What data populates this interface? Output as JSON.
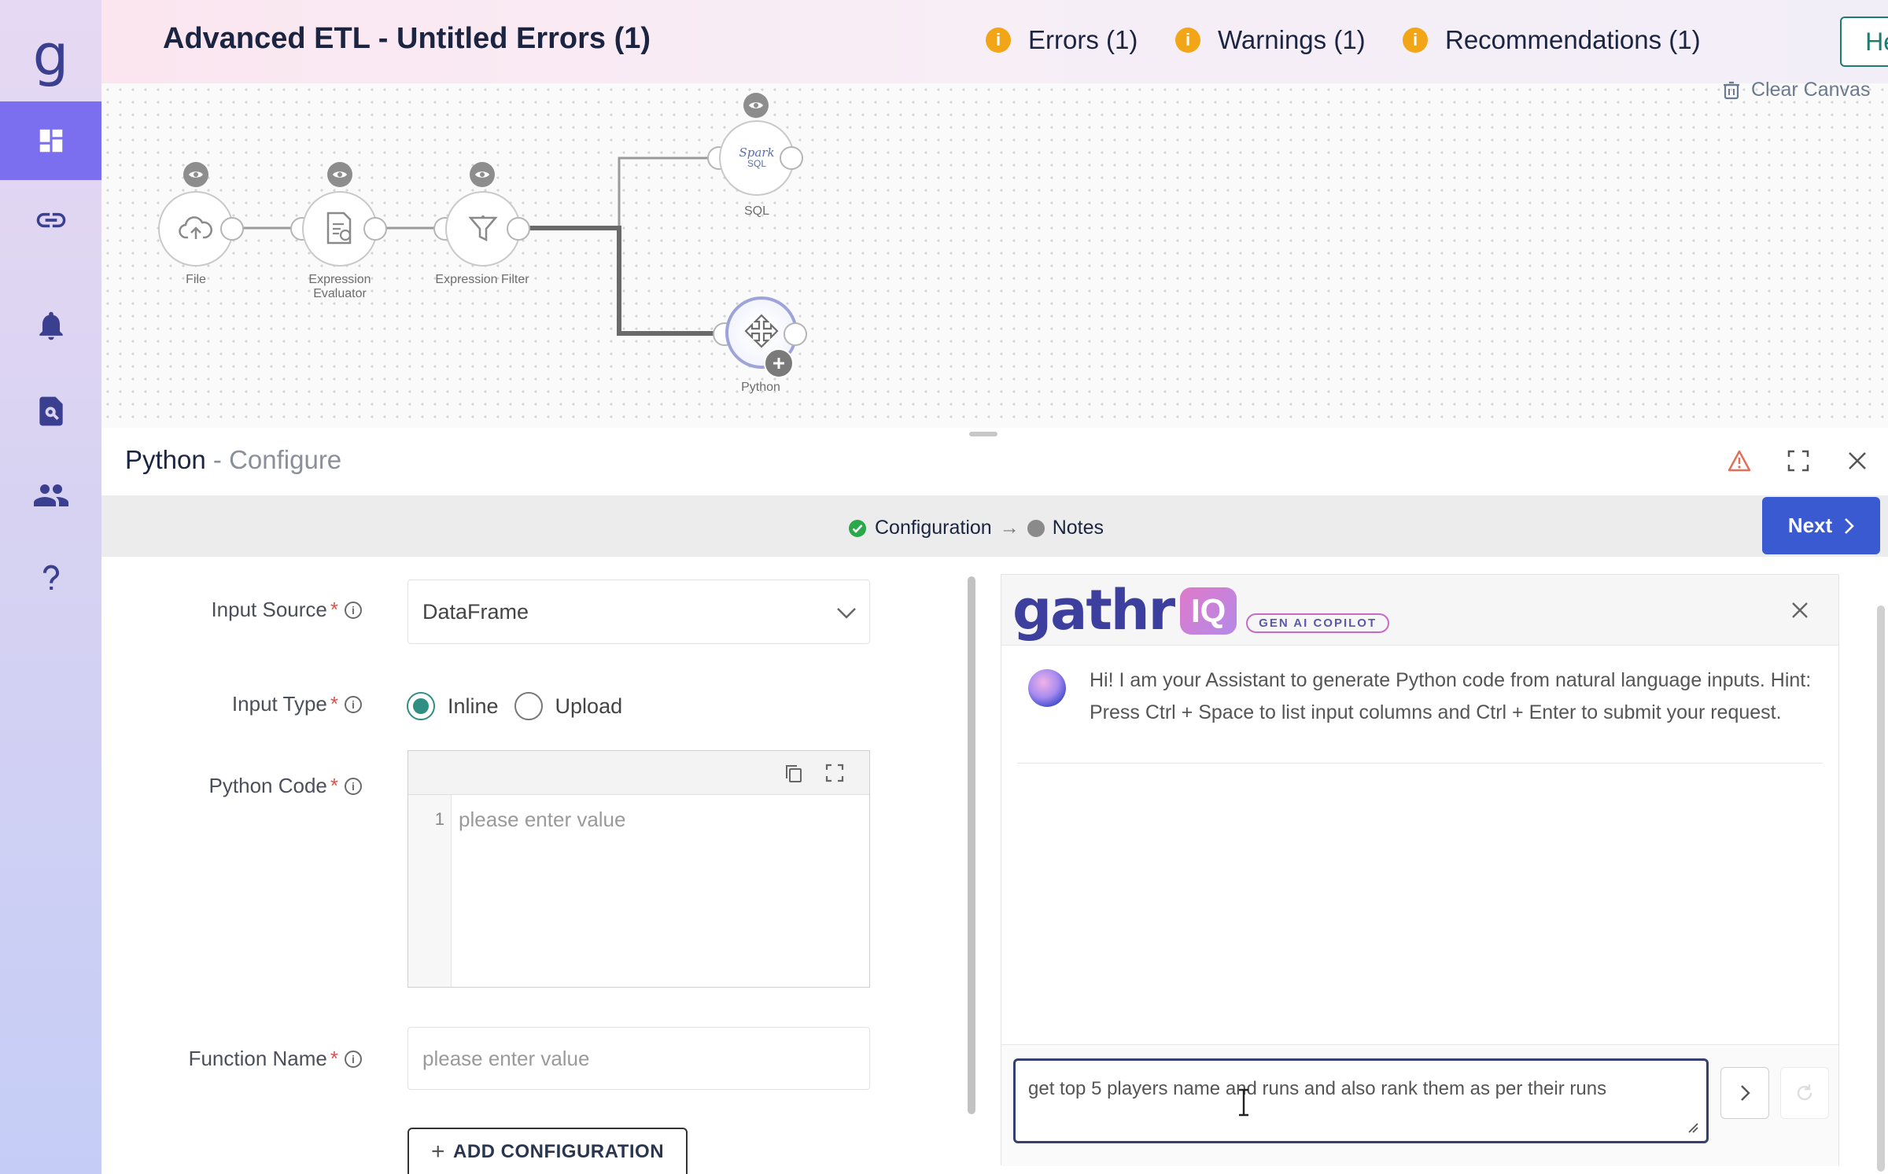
{
  "sidebar": {
    "logo": "g",
    "items": [
      {
        "icon": "dashboard-icon",
        "active": true
      },
      {
        "icon": "link-icon",
        "active": false
      },
      {
        "icon": "bell-icon",
        "active": false
      },
      {
        "icon": "search-document-icon",
        "active": false
      },
      {
        "icon": "users-icon",
        "active": false
      },
      {
        "icon": "help-icon",
        "active": false
      }
    ]
  },
  "header": {
    "title": "Advanced ETL - Untitled Errors (1)",
    "errors": "Errors (1)",
    "warnings": "Warnings (1)",
    "recommendations": "Recommendations (1)",
    "help": "Help",
    "info_glyph": "i"
  },
  "canvas": {
    "clear_label": "Clear Canvas",
    "nodes": [
      {
        "label": "File",
        "icon": "cloud-upload-icon"
      },
      {
        "label": "Expression Evaluator",
        "icon": "expression-evaluator-icon"
      },
      {
        "label": "Expression Filter",
        "icon": "funnel-icon"
      },
      {
        "label": "SQL",
        "icon": "spark-sql-icon",
        "logo_text": "Spark",
        "logo_sub": "SQL"
      },
      {
        "label": "Python",
        "icon": "python-icon"
      }
    ]
  },
  "panel": {
    "title": "Python",
    "subtitle": " - Configure",
    "steps": [
      {
        "label": "Configuration",
        "status": "done"
      },
      {
        "label": "Notes",
        "status": "pending"
      }
    ],
    "step_arrow": "→",
    "next": "Next"
  },
  "form": {
    "required_mark": "*",
    "info_glyph": "i",
    "input_source_label": "Input Source",
    "input_source_value": "DataFrame",
    "input_type_label": "Input Type",
    "input_type_options": [
      "Inline",
      "Upload"
    ],
    "input_type_selected": "Inline",
    "python_code_label": "Python Code",
    "code_line_number": "1",
    "code_placeholder": "please enter value",
    "function_name_label": "Function Name",
    "function_name_placeholder": "please enter value",
    "add_config_label": "ADD CONFIGURATION",
    "add_symbol": "+"
  },
  "copilot": {
    "logo_text": "gathr",
    "logo_iq": "IQ",
    "badge": "GEN AI COPILOT",
    "message": "Hi! I am your Assistant to generate Python code from natural language inputs. Hint: Press Ctrl + Space to list input columns and Ctrl + Enter to submit your request.",
    "input_value": "get top 5 players name and runs and also rank them as per their runs"
  },
  "colors": {
    "accent": "#3a5ad1",
    "sidebar_active": "#7b6ff0",
    "warning": "#f2a516",
    "teal": "#2e8f82"
  }
}
